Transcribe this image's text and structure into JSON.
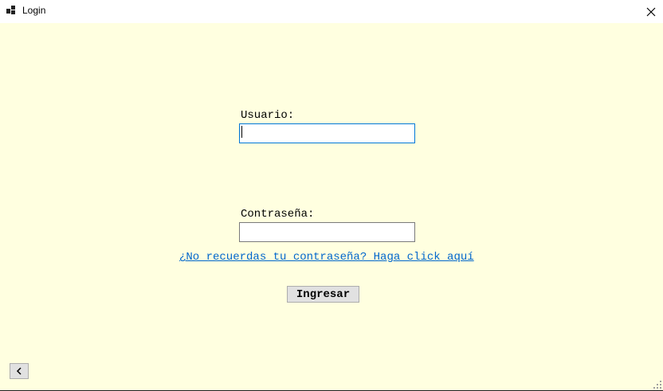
{
  "window": {
    "title": "Login"
  },
  "form": {
    "user_label": "Usuario:",
    "user_value": "",
    "password_label": "Contraseña:",
    "password_value": "",
    "forgot_link": "¿No recuerdas tu contraseña? Haga click aquí",
    "submit_label": "Ingresar"
  },
  "icons": {
    "app": "app-window-icon",
    "close": "close-icon",
    "back": "chevron-left-icon",
    "grip": "resize-grip-icon"
  },
  "colors": {
    "background": "#ffffe0",
    "link": "#0066cc",
    "focus_border": "#0078d7"
  }
}
